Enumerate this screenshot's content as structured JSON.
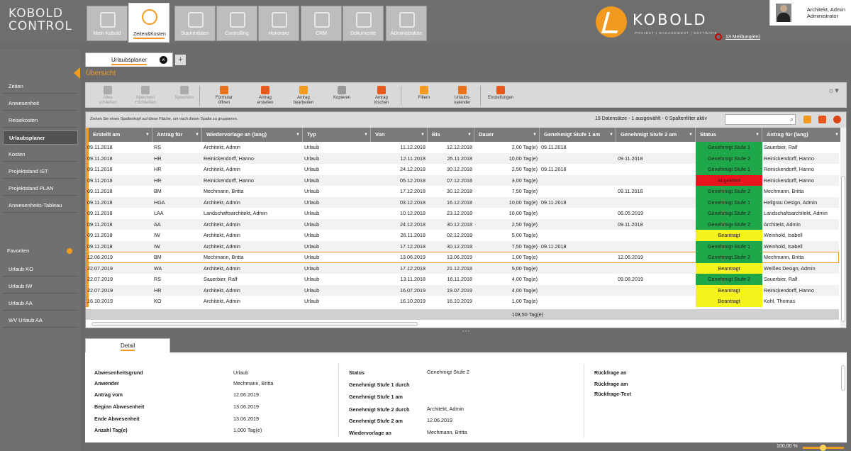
{
  "app": {
    "logo_line1": "KOBOLD",
    "logo_line2": "CONTROL",
    "brand": "KOBOLD",
    "brand_sub": "PROJEKT | MANAGEMENT | SOFTWARE"
  },
  "colors": {
    "accent": "#f29a1f",
    "approved": "#1fa84a",
    "rejected": "#e8161c",
    "requested": "#f6f21c"
  },
  "nav": [
    {
      "label": "Mein Kobold",
      "icon": "home-icon"
    },
    {
      "label": "Zeiten&Kosten",
      "icon": "stopwatch-icon",
      "active": true
    },
    {
      "label": "Stammdaten",
      "icon": "hierarchy-icon"
    },
    {
      "label": "Controlling",
      "icon": "calculator-icon"
    },
    {
      "label": "Honorare",
      "icon": "euro-icon"
    },
    {
      "label": "CRM",
      "icon": "contacts-icon"
    },
    {
      "label": "Dokumente",
      "icon": "documents-icon"
    },
    {
      "label": "Administration",
      "icon": "gears-icon"
    }
  ],
  "user": {
    "name": "Architekt, Admin",
    "role": "Administrator",
    "messages": "13 Meldung(en)"
  },
  "sidebar": {
    "items": [
      "Zeiten",
      "Anwesenheit",
      "Reisekosten",
      "Urlaubsplaner",
      "Kosten",
      "Projektstand IST",
      "Projektstand PLAN",
      "Anwesenheits-Tableau"
    ],
    "favorites_label": "Favoriten",
    "favorites": [
      "Urlaub KO",
      "Urlaub IW",
      "Urlaub AA",
      "WV Urlaub AA"
    ]
  },
  "doc_tab": {
    "label": "Urlaubsplaner",
    "add": "+"
  },
  "section_title": "Übersicht",
  "toolbar": [
    {
      "l1": "Alles",
      "l2": "schließen",
      "icon": "close-all-icon",
      "disabled": true
    },
    {
      "l1": "Speichern",
      "l2": "+Schließen",
      "icon": "save-close-icon",
      "disabled": true
    },
    {
      "l1": "Speichern",
      "l2": "",
      "icon": "save-icon",
      "disabled": true
    },
    {
      "l1": "Formular",
      "l2": "öffnen",
      "icon": "open-form-icon"
    },
    {
      "l1": "Antrag",
      "l2": "erstellen",
      "icon": "add-icon"
    },
    {
      "l1": "Antrag",
      "l2": "bearbeiten",
      "icon": "edit-icon"
    },
    {
      "l1": "Kopieren",
      "l2": "",
      "icon": "copy-icon"
    },
    {
      "l1": "Antrag",
      "l2": "löschen",
      "icon": "delete-icon"
    },
    {
      "l1": "Filtern",
      "l2": "",
      "icon": "filter-icon"
    },
    {
      "l1": "Urlaubs-",
      "l2": "kalender",
      "icon": "calendar-icon"
    },
    {
      "l1": "Einstellungen",
      "l2": "",
      "icon": "settings-icon"
    }
  ],
  "grid": {
    "hint": "Ziehen Sie einen Spaltenkopf auf diese Fläche, um nach dieser Spalte zu gruppieren.",
    "count": "19 Datensätze - 1 ausgewählt - 0 Spaltenfilter aktiv",
    "columns": [
      "Erstellt am",
      "Antrag für",
      "Wiedervorlage an (lang)",
      "Typ",
      "Von",
      "Bis",
      "Dauer",
      "Genehmigt Stufe 1 am",
      "Genehmigt Stufe 2 am",
      "Status",
      "Antrag für (lang)"
    ],
    "rows": [
      [
        "09.11.2018",
        "RS",
        "Architekt, Admin",
        "Urlaub",
        "11.12.2018",
        "12.12.2018",
        "2,00 Tag(e)",
        "09.11.2018",
        "",
        "Genehmigt Stufe 1",
        "Sauerbier, Ralf"
      ],
      [
        "09.11.2018",
        "HR",
        "Reinickendorff, Hanno",
        "Urlaub",
        "12.11.2018",
        "25.11.2018",
        "10,00 Tag(e)",
        "",
        "09.11.2018",
        "Genehmigt Stufe 2",
        "Reinickendorff, Hanno"
      ],
      [
        "09.11.2018",
        "HR",
        "Architekt, Admin",
        "Urlaub",
        "24.12.2018",
        "30.12.2018",
        "2,50 Tag(e)",
        "09.11.2018",
        "",
        "Genehmigt Stufe 1",
        "Reinickendorff, Hanno"
      ],
      [
        "09.11.2018",
        "HR",
        "Reinickendorff, Hanno",
        "Urlaub",
        "05.12.2018",
        "07.12.2018",
        "3,00 Tag(e)",
        "",
        "",
        "Abgelehnt",
        "Reinickendorff, Hanno"
      ],
      [
        "09.11.2018",
        "BM",
        "Mechmann, Britta",
        "Urlaub",
        "17.12.2018",
        "30.12.2018",
        "7,50 Tag(e)",
        "",
        "09.11.2018",
        "Genehmigt Stufe 2",
        "Mechmann, Britta"
      ],
      [
        "09.11.2018",
        "HGA",
        "Architekt, Admin",
        "Urlaub",
        "03.12.2018",
        "16.12.2018",
        "10,00 Tag(e)",
        "09.11.2018",
        "",
        "Genehmigt Stufe 1",
        "Hellgrau Design, Admin"
      ],
      [
        "09.11.2018",
        "LAA",
        "Landschaftsarchitekt, Admin",
        "Urlaub",
        "10.12.2018",
        "23.12.2018",
        "10,00 Tag(e)",
        "",
        "06.05.2019",
        "Genehmigt Stufe 2",
        "Landschaftsarchitekt, Admin"
      ],
      [
        "09.11.2018",
        "AA",
        "Architekt, Admin",
        "Urlaub",
        "24.12.2018",
        "30.12.2018",
        "2,50 Tag(e)",
        "",
        "09.11.2018",
        "Genehmigt Stufe 2",
        "Architekt, Admin"
      ],
      [
        "09.11.2018",
        "IW",
        "Architekt, Admin",
        "Urlaub",
        "26.11.2018",
        "02.12.2018",
        "5,00 Tag(e)",
        "",
        "",
        "Beantragt",
        "Weinhold, Isabell"
      ],
      [
        "09.11.2018",
        "IW",
        "Architekt, Admin",
        "Urlaub",
        "17.12.2018",
        "30.12.2018",
        "7,50 Tag(e)",
        "09.11.2018",
        "",
        "Genehmigt Stufe 1",
        "Weinhold, Isabell"
      ],
      [
        "12.06.2019",
        "BM",
        "Mechmann, Britta",
        "Urlaub",
        "13.06.2019",
        "13.06.2019",
        "1,00 Tag(e)",
        "",
        "12.06.2019",
        "Genehmigt Stufe 2",
        "Mechmann, Britta"
      ],
      [
        "22.07.2019",
        "WA",
        "Architekt, Admin",
        "Urlaub",
        "17.12.2018",
        "21.12.2018",
        "5,00 Tag(e)",
        "",
        "",
        "Beantragt",
        "Weißes Design, Admin"
      ],
      [
        "22.07.2019",
        "RS",
        "Sauerbier, Ralf",
        "Urlaub",
        "13.11.2018",
        "16.11.2018",
        "4,00 Tag(e)",
        "",
        "09.08.2019",
        "Genehmigt Stufe 2",
        "Sauerbier, Ralf"
      ],
      [
        "22.07.2019",
        "HR",
        "Architekt, Admin",
        "Urlaub",
        "16.07.2019",
        "19.07.2019",
        "4,00 Tag(e)",
        "",
        "",
        "Beantragt",
        "Reinickendorff, Hanno"
      ],
      [
        "16.10.2019",
        "KO",
        "Architekt, Admin",
        "Urlaub",
        "16.10.2019",
        "16.10.2019",
        "1,00 Tag(e)",
        "",
        "",
        "Beantragt",
        "Kohl, Thomas"
      ]
    ],
    "selected_row": 10,
    "sum": "108,50 Tag(e)"
  },
  "detail": {
    "tab": "Detail",
    "left": [
      {
        "label": "Abwesenheitsgrund",
        "value": "Urlaub"
      },
      {
        "label": "Anwender",
        "value": "Mechmann, Britta"
      },
      {
        "label": "Antrag vom",
        "value": "12.06.2019"
      },
      {
        "label": "Beginn Abwesenheit",
        "value": "13.06.2019"
      },
      {
        "label": "Ende Abwesenheit",
        "value": "13.06.2019"
      },
      {
        "label": "Anzahl Tag(e)",
        "value": "1,000 Tag(e)"
      }
    ],
    "middle": [
      {
        "label": "Status",
        "value": "Genehmigt Stufe 2"
      },
      {
        "label": "Genehmigt Stufe 1 durch",
        "value": ""
      },
      {
        "label": "Genehmigt Stufe 1 am",
        "value": ""
      },
      {
        "label": "Genehmigt Stufe 2 durch",
        "value": "Architekt, Admin"
      },
      {
        "label": "Genehmigt Stufe 2 am",
        "value": "12.06.2019"
      },
      {
        "label": "Wiedervorlage an",
        "value": "Mechmann, Britta"
      }
    ],
    "right": [
      {
        "label": "Rückfrage an"
      },
      {
        "label": "Rückfrage am"
      },
      {
        "label": "Rückfrage-Text"
      }
    ]
  },
  "zoom": "100,00 %"
}
